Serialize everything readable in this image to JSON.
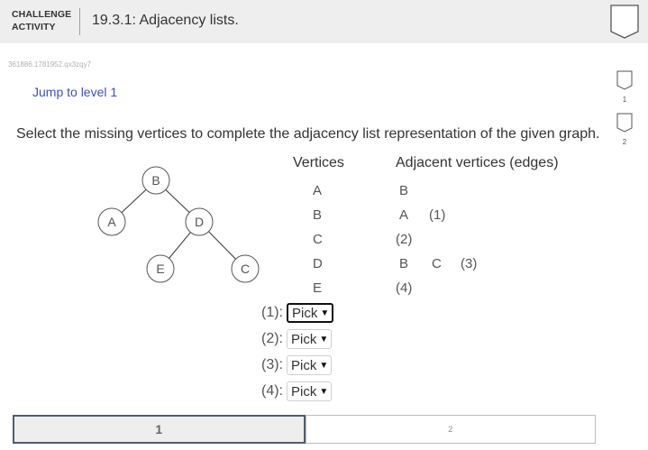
{
  "header": {
    "activity_line1": "CHALLENGE",
    "activity_line2": "ACTIVITY",
    "title": "19.3.1: Adjacency lists."
  },
  "activity_id": "361886.1781952.qx3zqy7",
  "jump_label": "Jump to level 1",
  "level_markers": [
    "1",
    "2"
  ],
  "instructions": "Select the missing vertices to complete the adjacency list representation of the given graph.",
  "graph": {
    "nodes": [
      "B",
      "A",
      "D",
      "E",
      "C"
    ],
    "edges": [
      [
        "B",
        "A"
      ],
      [
        "B",
        "D"
      ],
      [
        "D",
        "E"
      ],
      [
        "D",
        "C"
      ]
    ]
  },
  "table": {
    "vertices_header": "Vertices",
    "adjacent_header": "Adjacent vertices (edges)",
    "rows": [
      {
        "vertex": "A",
        "adj": [
          "B"
        ]
      },
      {
        "vertex": "B",
        "adj": [
          "A",
          "(1)"
        ]
      },
      {
        "vertex": "C",
        "adj": [
          "(2)"
        ]
      },
      {
        "vertex": "D",
        "adj": [
          "B",
          "C",
          "(3)"
        ]
      },
      {
        "vertex": "E",
        "adj": [
          "(4)"
        ]
      }
    ]
  },
  "picks": [
    {
      "label": "(1):",
      "value": "Pick"
    },
    {
      "label": "(2):",
      "value": "Pick"
    },
    {
      "label": "(3):",
      "value": "Pick"
    },
    {
      "label": "(4):",
      "value": "Pick"
    }
  ],
  "levels": [
    "1",
    "2"
  ]
}
